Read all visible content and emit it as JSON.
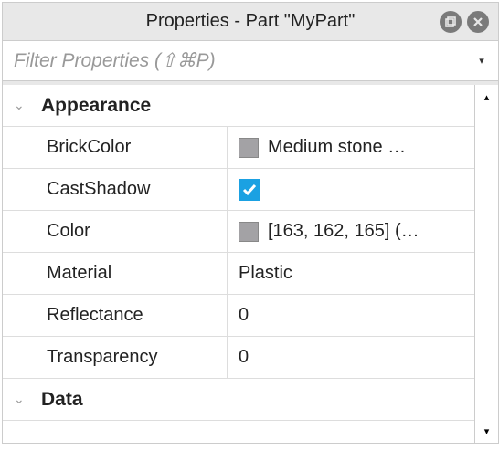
{
  "title": "Properties - Part \"MyPart\"",
  "filter": {
    "placeholder": "Filter Properties (⇧⌘P)"
  },
  "sections": {
    "appearance": {
      "title": "Appearance",
      "rows": {
        "brickColor": {
          "label": "BrickColor",
          "value": "Medium stone …",
          "swatch": "#a3a2a5"
        },
        "castShadow": {
          "label": "CastShadow",
          "checked": true
        },
        "color": {
          "label": "Color",
          "value": "[163, 162, 165] (…",
          "swatch": "#a3a2a5"
        },
        "material": {
          "label": "Material",
          "value": "Plastic"
        },
        "reflectance": {
          "label": "Reflectance",
          "value": "0"
        },
        "transparency": {
          "label": "Transparency",
          "value": "0"
        }
      }
    },
    "data": {
      "title": "Data"
    }
  }
}
